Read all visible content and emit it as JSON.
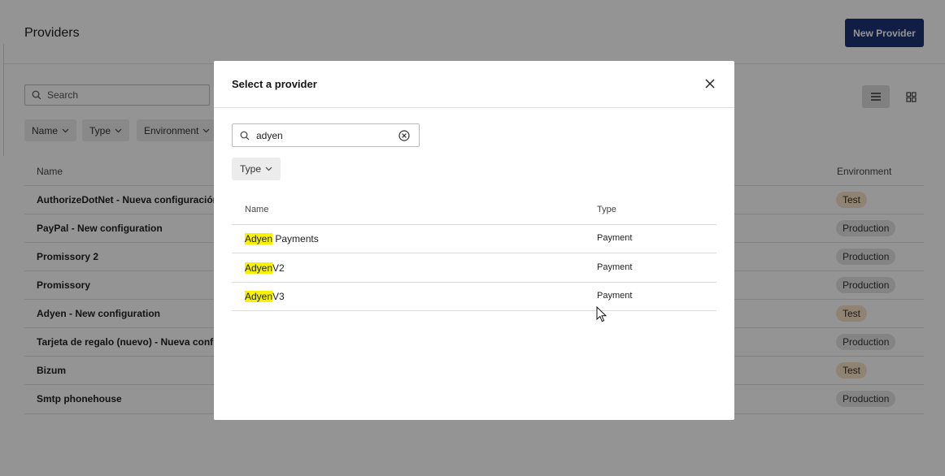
{
  "page": {
    "title": "Providers",
    "new_button": "New Provider",
    "search": {
      "placeholder": "Search"
    },
    "filters": [
      {
        "label": "Name"
      },
      {
        "label": "Type"
      },
      {
        "label": "Environment"
      }
    ],
    "table": {
      "columns": {
        "name": "Name",
        "environment": "Environment"
      },
      "rows": [
        {
          "name": "AuthorizeDotNet - Nueva configuración",
          "environment": "Test"
        },
        {
          "name": "PayPal - New configuration",
          "environment": "Production"
        },
        {
          "name": "Promissory 2",
          "environment": "Production"
        },
        {
          "name": "Promissory",
          "environment": "Production"
        },
        {
          "name": "Adyen - New configuration",
          "environment": "Test"
        },
        {
          "name": "Tarjeta de regalo (nuevo) - Nueva configu",
          "environment": "Production"
        },
        {
          "name": "Bizum",
          "environment": "Test"
        },
        {
          "name": "Smtp phonehouse",
          "environment": "Production"
        }
      ]
    }
  },
  "modal": {
    "title": "Select a provider",
    "search_value": "adyen",
    "filter_label": "Type",
    "columns": {
      "name": "Name",
      "type": "Type"
    },
    "rows": [
      {
        "match": "Adyen",
        "rest": " Payments",
        "type": "Payment"
      },
      {
        "match": "Adyen",
        "rest": "V2",
        "type": "Payment"
      },
      {
        "match": "Adyen",
        "rest": "V3",
        "type": "Payment"
      }
    ]
  },
  "colors": {
    "primary": "#1c3578",
    "highlight": "#f6f200",
    "badge_test": "#f7e2c6",
    "badge_production": "#e3e3e3"
  },
  "icons": {
    "search": "search-icon",
    "clear": "clear-circle-icon",
    "close": "close-icon",
    "chevron": "chevron-down-icon",
    "list_view": "list-view-icon",
    "grid_view": "grid-view-icon"
  }
}
